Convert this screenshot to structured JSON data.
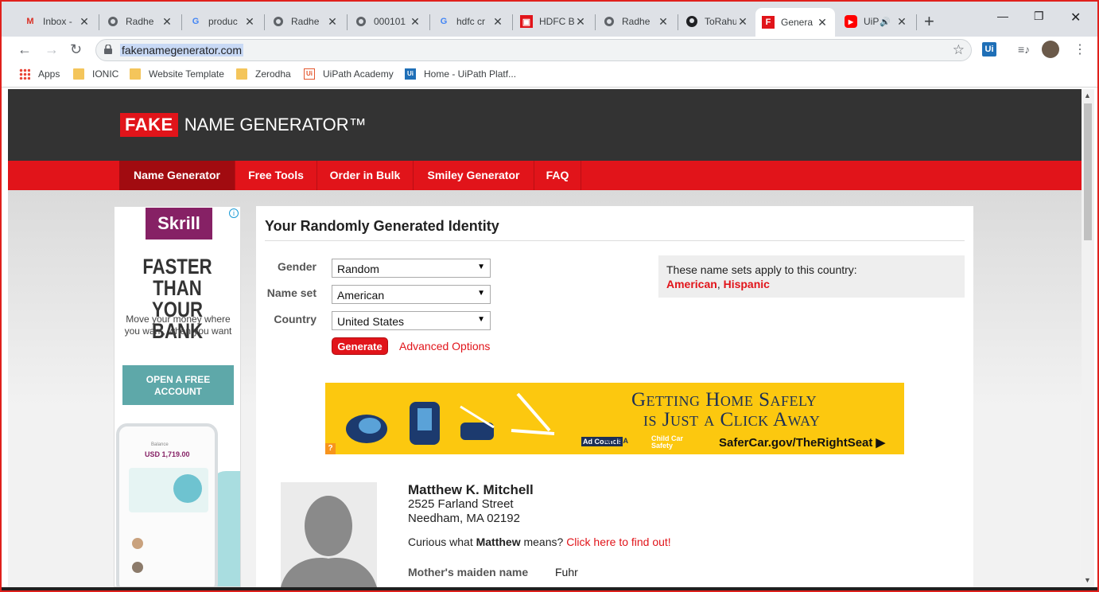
{
  "browser": {
    "tabs": [
      {
        "title": "Inbox -",
        "icon": "gmail-icon"
      },
      {
        "title": "Radhe",
        "icon": "globe-icon"
      },
      {
        "title": "produc",
        "icon": "google-icon"
      },
      {
        "title": "Radhe",
        "icon": "globe-icon"
      },
      {
        "title": "000101",
        "icon": "globe-icon"
      },
      {
        "title": "hdfc cr",
        "icon": "google-icon"
      },
      {
        "title": "HDFC B",
        "icon": "hdfc-icon"
      },
      {
        "title": "Radhe",
        "icon": "globe-icon"
      },
      {
        "title": "ToRahu",
        "icon": "github-icon"
      },
      {
        "title": "Genera",
        "icon": "fakename-icon",
        "active": true
      },
      {
        "title": "UiP",
        "icon": "youtube-icon"
      }
    ],
    "url": "fakenamegenerator.com",
    "bookmarks": [
      {
        "label": "Apps",
        "icon": "apps-grid-icon"
      },
      {
        "label": "IONIC",
        "icon": "folder-icon"
      },
      {
        "label": "Website Template",
        "icon": "folder-icon"
      },
      {
        "label": "Zerodha",
        "icon": "folder-icon"
      },
      {
        "label": "UiPath Academy",
        "icon": "uipath-icon"
      },
      {
        "label": "Home - UiPath Platf...",
        "icon": "uipath-icon"
      }
    ],
    "ext_label": "Ui"
  },
  "site": {
    "logo_fake": "FAKE",
    "logo_rest": "NAME GENERATOR™",
    "nav": [
      "Name Generator",
      "Free Tools",
      "Order in Bulk",
      "Smiley Generator",
      "FAQ"
    ],
    "colors": {
      "brand_red": "#e1141a",
      "header_dark": "#333333"
    }
  },
  "ad": {
    "brand": "Skrill",
    "headline_1": "FASTER THAN",
    "headline_2": "YOUR BANK",
    "sub": "Move your money where you want, when you want",
    "cta_1": "OPEN A FREE",
    "cta_2": "ACCOUNT",
    "phone_balance_label": "Balance",
    "phone_balance": "USD 1,719.00"
  },
  "main": {
    "title": "Your Randomly Generated Identity",
    "form": {
      "gender_label": "Gender",
      "gender_value": "Random",
      "nameset_label": "Name set",
      "nameset_value": "American",
      "country_label": "Country",
      "country_value": "United States",
      "generate_label": "Generate",
      "advanced_label": "Advanced Options"
    },
    "info": {
      "text": "These name sets apply to this country:",
      "link1": "American",
      "sep": ",",
      "link2": "Hispanic"
    },
    "banner": {
      "line1": "Getting Home Safely",
      "line2": "is Just a Click Away",
      "site": "SaferCar.gov/TheRightSeat ▶",
      "tag_ad": "Ad Council",
      "tag_nhtsa": "NHTSA",
      "tag_child": "Child Car Safety"
    },
    "identity": {
      "name": "Matthew K. Mitchell",
      "street": "2525 Farland Street",
      "city": "Needham, MA 02192",
      "curious_pre": "Curious what",
      "curious_name": "Matthew",
      "curious_mid": "means?",
      "curious_link": "Click here to find out!",
      "maiden_label": "Mother's maiden name",
      "maiden_value": "Fuhr"
    }
  }
}
